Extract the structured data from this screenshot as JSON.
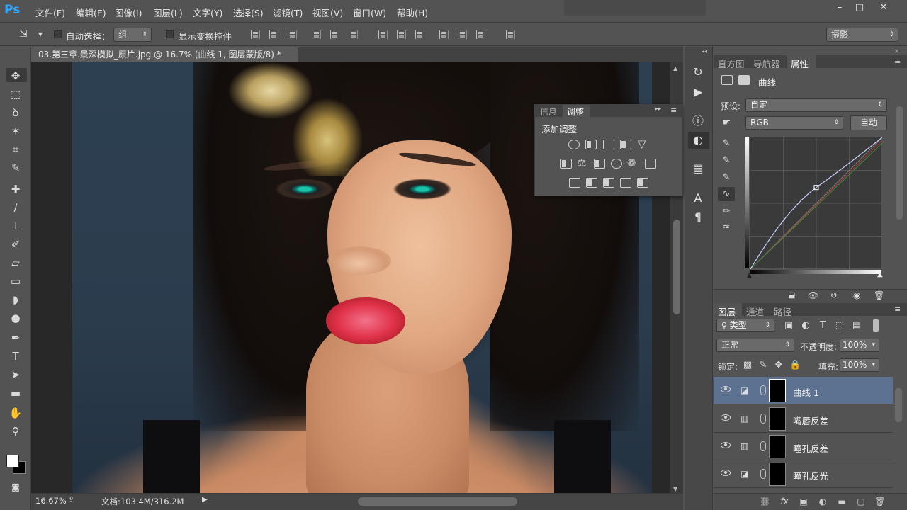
{
  "app": {
    "logo": "Ps"
  },
  "menu": [
    "文件(F)",
    "编辑(E)",
    "图像(I)",
    "图层(L)",
    "文字(Y)",
    "选择(S)",
    "滤镜(T)",
    "视图(V)",
    "窗口(W)",
    "帮助(H)"
  ],
  "window_controls": [
    "–",
    "□",
    "✕"
  ],
  "options_bar": {
    "auto_select_label": "自动选择：",
    "auto_select_value": "组",
    "show_transform_label": "显示变换控件",
    "workspace": "摄影"
  },
  "document_tab": "03.第三章.景深模拟_原片.jpg @ 16.7% (曲线 1, 图层蒙版/8) *",
  "status_bar": {
    "zoom": "16.67%",
    "doc_info": "文档:103.4M/316.2M"
  },
  "adjustments_panel": {
    "tabs": [
      "信息",
      "调整"
    ],
    "active_tab": "调整",
    "title": "添加调整"
  },
  "properties_panel": {
    "tabs": [
      "直方图",
      "导航器",
      "属性"
    ],
    "active_tab": "属性",
    "title": "曲线",
    "preset_label": "预设:",
    "preset_value": "自定",
    "channel_value": "RGB",
    "auto_button": "自动",
    "curve_point": {
      "input": 50,
      "output": 62
    }
  },
  "layers_panel": {
    "tabs": [
      "图层",
      "通道",
      "路径"
    ],
    "active_tab": "图层",
    "filter_kind": "类型",
    "blend_mode": "正常",
    "opacity_label": "不透明度:",
    "opacity_value": "100%",
    "lock_label": "锁定:",
    "fill_label": "填充:",
    "fill_value": "100%",
    "layers": [
      {
        "name": "曲线 1",
        "type": "curves",
        "selected": true
      },
      {
        "name": "嘴唇反差",
        "type": "levels",
        "selected": false
      },
      {
        "name": "瞳孔反差",
        "type": "levels",
        "selected": false
      },
      {
        "name": "瞳孔反光",
        "type": "curves",
        "selected": false
      }
    ]
  },
  "colors": {
    "accent_selected": "#5d7291",
    "ps_blue": "#31a8ff",
    "panel_bg": "#535353"
  }
}
